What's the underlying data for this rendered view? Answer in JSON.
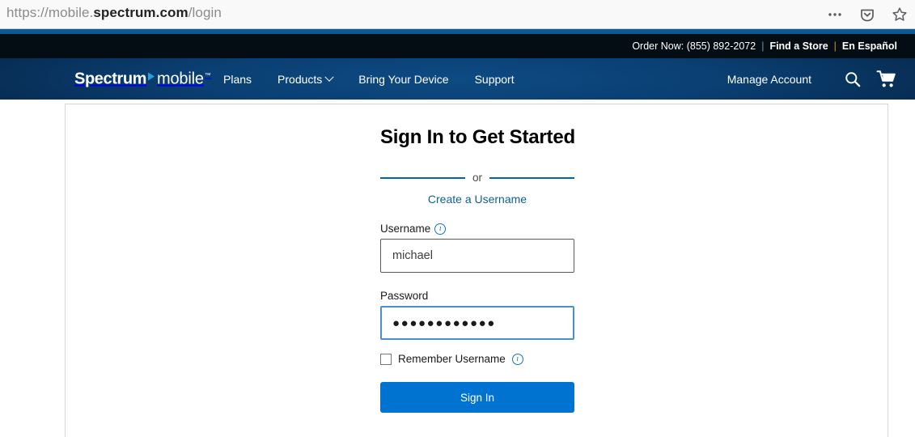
{
  "browser": {
    "url_prefix": "https://mobile.",
    "url_host": "spectrum.com",
    "url_suffix": "/login",
    "icons": [
      {
        "name": "more-options-icon",
        "glyph": "···"
      },
      {
        "name": "pocket-icon",
        "glyph": "pocket"
      },
      {
        "name": "bookmark-star-icon",
        "glyph": "☆"
      }
    ]
  },
  "utility_bar": {
    "order_now_label": "Order Now: (855) 892-2072",
    "separator_1": "|",
    "find_a_store": "Find a Store",
    "separator_2": "|",
    "en_espanol": "En Español"
  },
  "navbar": {
    "logo": {
      "primary": "Spectrum",
      "secondary": "mobile",
      "trademark": "™"
    },
    "links": [
      {
        "label": "Plans",
        "has_caret": false
      },
      {
        "label": "Products",
        "has_caret": true
      },
      {
        "label": "Bring Your Device",
        "has_caret": false
      },
      {
        "label": "Support",
        "has_caret": false
      }
    ],
    "manage_account": "Manage Account",
    "search_icon": "search-icon",
    "cart_icon": "shopping-cart-icon"
  },
  "form": {
    "title": "Sign In to Get Started",
    "or_label": "or",
    "create_username_link": "Create a Username",
    "username_label": "Username",
    "username_info_icon": "ı",
    "username_value": "michael",
    "username_placeholder": "Username",
    "password_label": "Password",
    "password_value": "●●●●●●●●●●●●",
    "password_placeholder": "Password",
    "remember_label": "Remember Username",
    "remember_info_icon": "ı",
    "remember_checked": false,
    "signin_label": "Sign In"
  },
  "colors": {
    "brand_blue": "#0073d1",
    "nav_dark": "#041d3a",
    "utility_dark": "#050d14",
    "link_blue": "#0f6094",
    "divider_blue": "#0062b2",
    "accent_stripe": "#0a5a8e"
  }
}
